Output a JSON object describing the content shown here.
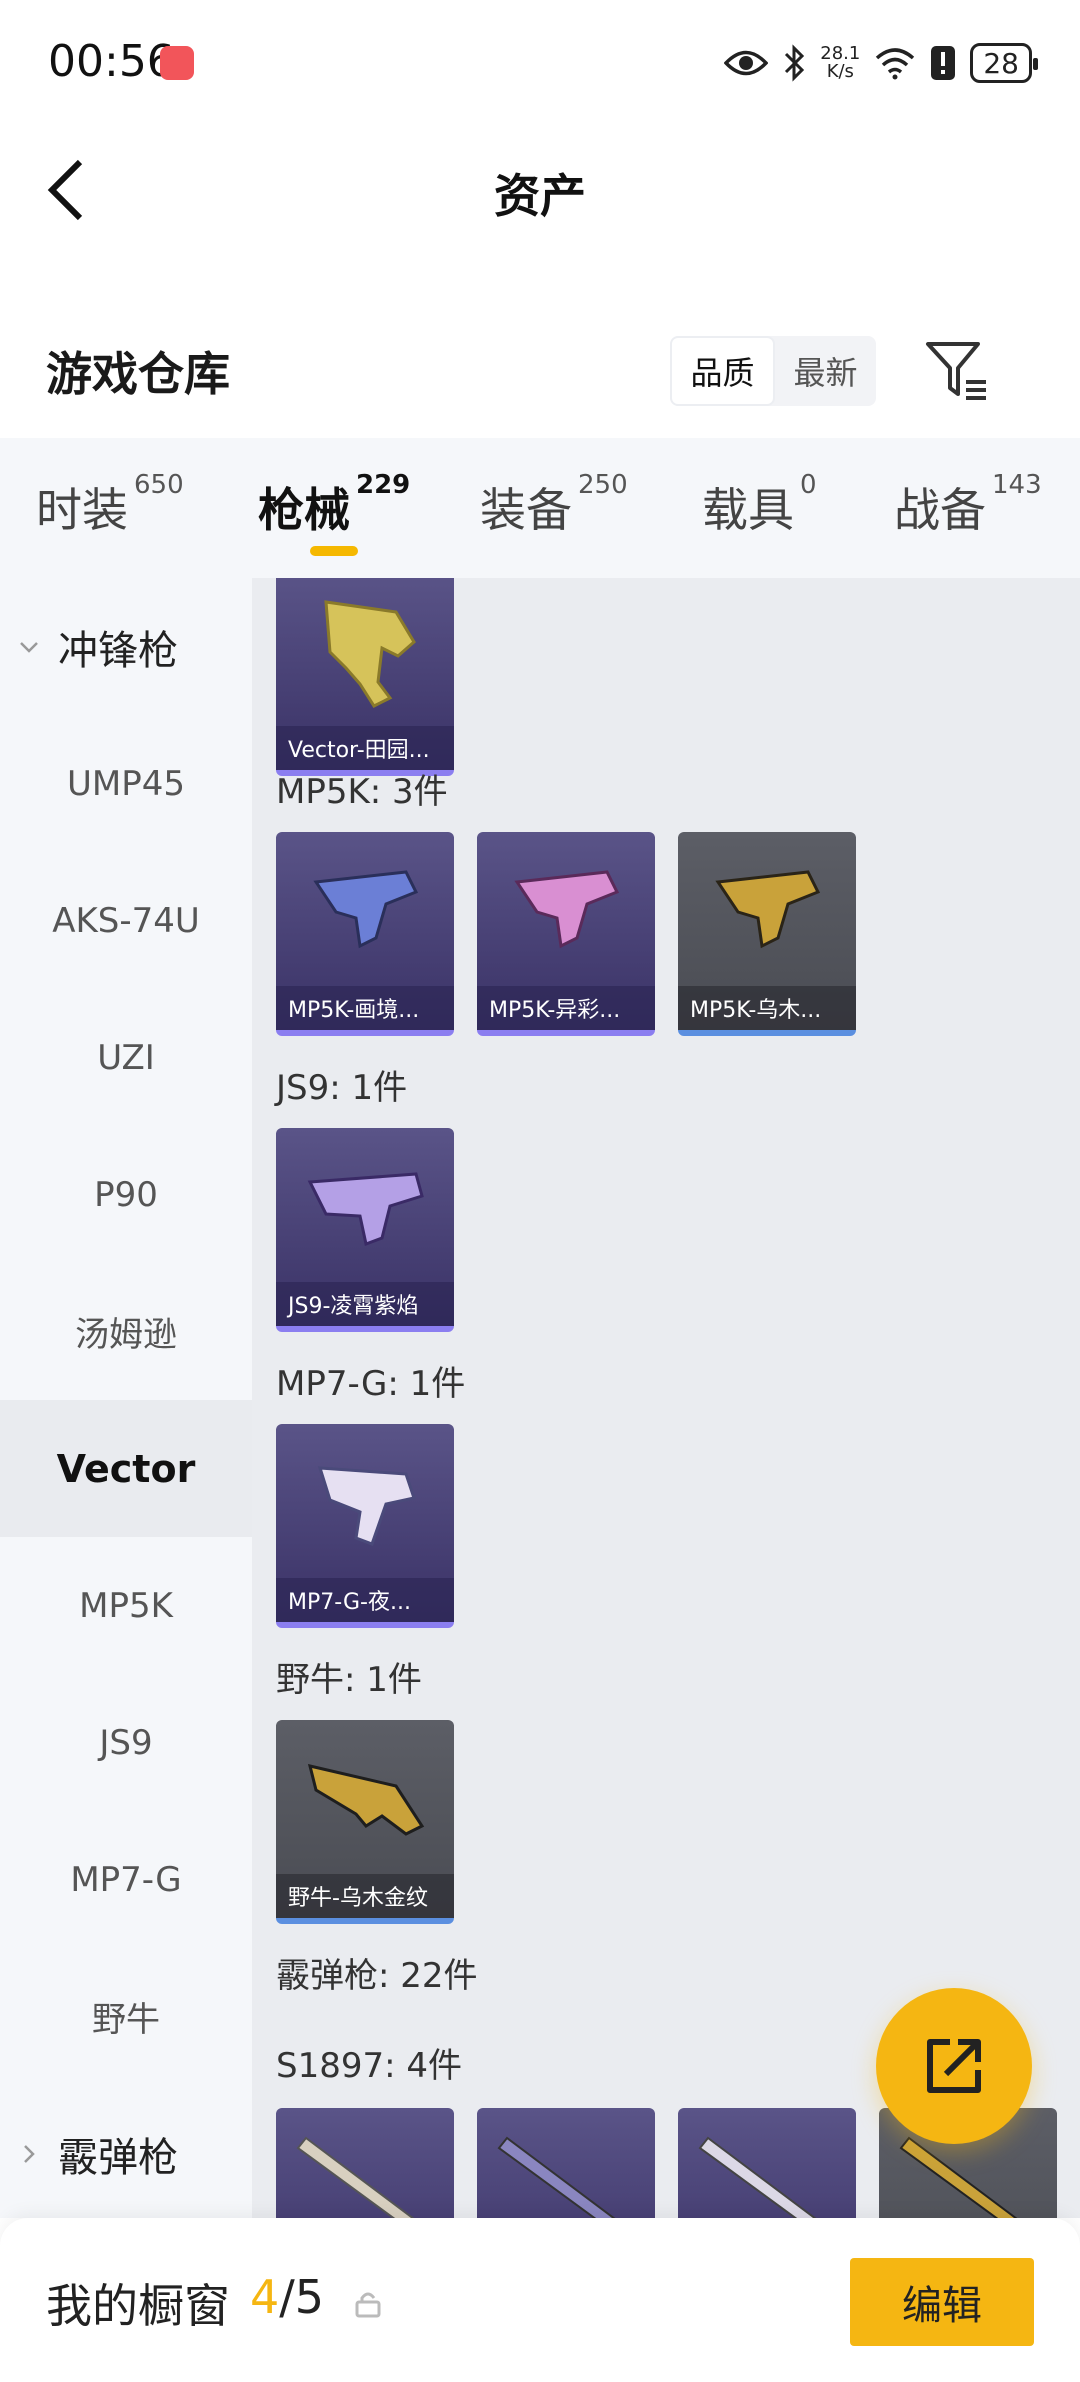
{
  "status_bar": {
    "time": "00:56",
    "net_speed_value": "28.1",
    "net_speed_unit": "K/s",
    "battery": "28",
    "icons": [
      "eye-icon",
      "bluetooth-icon",
      "wifi-icon",
      "alert-icon",
      "battery-icon"
    ]
  },
  "header": {
    "title": "资产"
  },
  "section": {
    "title": "游戏仓库",
    "sort_options": [
      "品质",
      "最新"
    ],
    "sort_selected": "品质"
  },
  "tabs": [
    {
      "label": "时装",
      "count": "650"
    },
    {
      "label": "枪械",
      "count": "229",
      "active": true
    },
    {
      "label": "装备",
      "count": "250"
    },
    {
      "label": "载具",
      "count": "0"
    },
    {
      "label": "战备",
      "count": "143"
    }
  ],
  "sidebar": [
    {
      "label": "冲锋枪",
      "type": "group",
      "expanded": true
    },
    {
      "label": "UMP45"
    },
    {
      "label": "AKS-74U"
    },
    {
      "label": "UZI"
    },
    {
      "label": "P90"
    },
    {
      "label": "汤姆逊"
    },
    {
      "label": "Vector",
      "active": true
    },
    {
      "label": "MP5K"
    },
    {
      "label": "JS9"
    },
    {
      "label": "MP7-G"
    },
    {
      "label": "野牛"
    },
    {
      "label": "霰弹枪",
      "type": "group",
      "expanded": false
    }
  ],
  "groups": [
    {
      "label": "",
      "items": [
        {
          "name": "Vector-田园...",
          "quality": "purple"
        }
      ]
    },
    {
      "label": "MP5K: 3件",
      "items": [
        {
          "name": "MP5K-画境...",
          "quality": "purple"
        },
        {
          "name": "MP5K-异彩...",
          "quality": "purple"
        },
        {
          "name": "MP5K-乌木...",
          "quality": "gray"
        }
      ]
    },
    {
      "label": "JS9: 1件",
      "items": [
        {
          "name": "JS9-凌霄紫焰",
          "quality": "purple"
        }
      ]
    },
    {
      "label": "MP7-G: 1件",
      "items": [
        {
          "name": "MP7-G-夜...",
          "quality": "purple"
        }
      ]
    },
    {
      "label": "野牛: 1件",
      "items": [
        {
          "name": "野牛-乌木金纹",
          "quality": "gray"
        }
      ]
    },
    {
      "label": "霰弹枪: 22件",
      "items": []
    },
    {
      "label": "S1897: 4件",
      "items": [
        {
          "name": "",
          "quality": "purple"
        },
        {
          "name": "",
          "quality": "purple"
        },
        {
          "name": "",
          "quality": "purple"
        },
        {
          "name": "",
          "quality": "gray"
        }
      ]
    }
  ],
  "bottom_bar": {
    "label": "我的橱窗",
    "count_current": "4",
    "count_separator": "/",
    "count_total": "5",
    "edit_label": "编辑"
  },
  "colors": {
    "accent": "#f5b612",
    "purple_card": "#4a4378",
    "gray_card": "#55575e",
    "sidebar_bg": "#f5f7fa",
    "content_bg": "#eaecf0"
  }
}
